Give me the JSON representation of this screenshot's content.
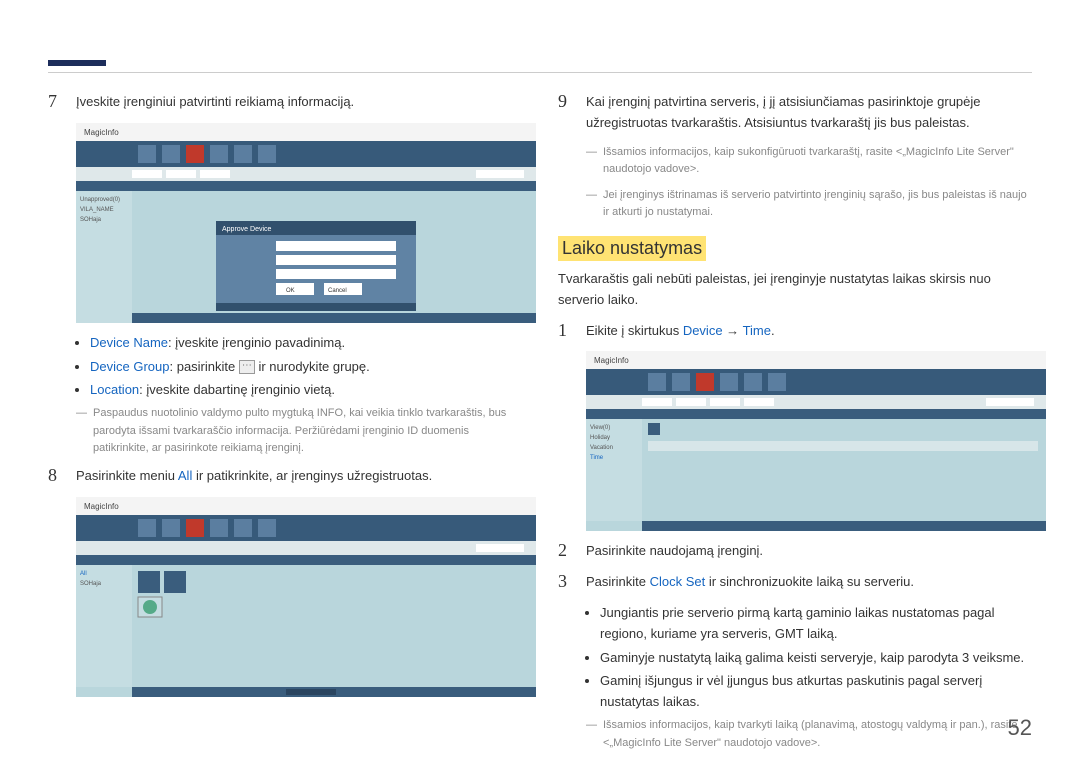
{
  "page_number": "52",
  "left": {
    "step7": {
      "num": "7",
      "text": "Įveskite įrenginiui patvirtinti reikiamą informaciją.",
      "bullet1a": "Device Name",
      "bullet1b": ": įveskite įrenginio pavadinimą.",
      "bullet2a": "Device Group",
      "bullet2b": ": pasirinkite ",
      "bullet2c": " ir nurodykite grupę.",
      "bullet3a": "Location",
      "bullet3b": ": įveskite dabartinę įrenginio vietą.",
      "note": "Paspaudus nuotolinio valdymo pulto mygtuką INFO, kai veikia tinklo tvarkaraštis, bus parodyta išsami tvarkaraščio informacija. Peržiūrėdami įrenginio ID duomenis patikrinkite, ar pasirinkote reikiamą įrenginį."
    },
    "step8": {
      "num": "8",
      "text_a": "Pasirinkite meniu ",
      "term": "All",
      "text_b": " ir patikrinkite, ar įrenginys užregistruotas."
    }
  },
  "right": {
    "step9": {
      "num": "9",
      "text": "Kai įrenginį patvirtina serveris, į jį atsisiunčiamas pasirinktoje grupėje užregistruotas tvarkaraštis. Atsisiuntus tvarkaraštį jis bus paleistas.",
      "note1": "Išsamios informacijos, kaip sukonfigūruoti tvarkaraštį, rasite <„MagicInfo Lite Server\" naudotojo vadove>.",
      "note2": "Jei įrenginys ištrinamas iš serverio patvirtinto įrenginių sąrašo, jis bus paleistas iš naujo ir atkurti jo nustatymai."
    },
    "heading": "Laiko nustatymas",
    "intro": "Tvarkaraštis gali nebūti paleistas, jei įrenginyje nustatytas laikas skirsis nuo serverio laiko.",
    "step1": {
      "num": "1",
      "text_a": "Eikite į skirtukus ",
      "term1": "Device",
      "arrow": " → ",
      "term2": "Time",
      "text_b": "."
    },
    "step2": {
      "num": "2",
      "text": "Pasirinkite naudojamą įrenginį."
    },
    "step3": {
      "num": "3",
      "text_a": "Pasirinkite ",
      "term": "Clock Set",
      "text_b": " ir sinchronizuokite laiką su serveriu.",
      "b1": "Jungiantis prie serverio pirmą kartą gaminio laikas nustatomas pagal regiono, kuriame yra serveris, GMT laiką.",
      "b2": "Gaminyje nustatytą laiką galima keisti serveryje, kaip parodyta 3 veiksme.",
      "b3": "Gaminį išjungus ir vėl įjungus bus atkurtas paskutinis pagal serverį nustatytas laikas.",
      "note": "Išsamios informacijos, kaip tvarkyti laiką (planavimą, atostogų valdymą ir pan.), rasite <„MagicInfo Lite Server\" naudotojo vadove>."
    }
  }
}
